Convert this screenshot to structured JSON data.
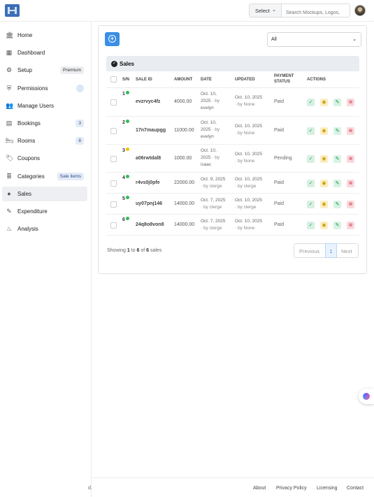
{
  "header": {
    "logo": "logo",
    "select_label": "Select",
    "search_placeholder": "Search Mockups, Logos,"
  },
  "sidebar": {
    "items": [
      {
        "label": "Home",
        "icon": "bank-icon"
      },
      {
        "label": "Dashboard",
        "icon": "grid-icon"
      },
      {
        "label": "Setup",
        "icon": "gear-icon",
        "badge": "Premium"
      },
      {
        "label": "Permissions",
        "icon": "shield-icon"
      },
      {
        "label": "Manage Users",
        "icon": "users-icon"
      },
      {
        "label": "Bookings",
        "icon": "book-icon",
        "badge": "3"
      },
      {
        "label": "Rooms",
        "icon": "bed-icon",
        "badge": "8"
      },
      {
        "label": "Coupons",
        "icon": "coupon-icon"
      },
      {
        "label": "Categories",
        "icon": "layers-icon",
        "badge": "Sale items"
      },
      {
        "label": "Sales",
        "icon": "sales-icon",
        "active": true
      },
      {
        "label": "Expenditure",
        "icon": "edit-icon"
      },
      {
        "label": "Analysis",
        "icon": "analysis-icon"
      }
    ]
  },
  "main": {
    "filter_value": "All",
    "panel_title": "Sales",
    "columns": [
      "S/N",
      "SALE ID",
      "AMOUNT",
      "DATE",
      "UPDATED",
      "PAYMENT",
      "STATUS",
      "ACTIONS"
    ],
    "rows": [
      {
        "sn": "1",
        "status_color": "#2ebd59",
        "sale_id": "evzrvyc4fz",
        "amount": "4000.00",
        "date_l1": "Oct. 10,",
        "date_l2": "2025",
        "date_by": "· by",
        "date_l3": "evelyn",
        "up_l1": "Oct. 10, 2025",
        "up_l2": "· by None",
        "payment": "Paid"
      },
      {
        "sn": "2",
        "status_color": "#2ebd59",
        "sale_id": "17n7maupgg",
        "amount": "11000.00",
        "date_l1": "Oct. 10,",
        "date_l2": "2025",
        "date_by": "· by",
        "date_l3": "evelyn",
        "up_l1": "Oct. 10, 2025",
        "up_l2": "· by None",
        "payment": "Paid"
      },
      {
        "sn": "3",
        "status_color": "#f2c200",
        "sale_id": "a06rwtdal8",
        "amount": "1000.00",
        "date_l1": "Oct. 10,",
        "date_l2": "2025",
        "date_by": "· by",
        "date_l3": "isaac",
        "up_l1": "Oct. 10, 2025",
        "up_l2": "· by None",
        "payment": "Pending"
      },
      {
        "sn": "4",
        "status_color": "#2ebd59",
        "sale_id": "r4vs0j0pfe",
        "amount": "22000.00",
        "date_l1": "Oct. 9, 2025",
        "date_l2": "· by clerge",
        "up_l1": "Oct. 10, 2025",
        "up_l2": "· by clerge",
        "payment": "Paid"
      },
      {
        "sn": "5",
        "status_color": "#2ebd59",
        "sale_id": "uy07pnj146",
        "amount": "14000.00",
        "date_l1": "Oct. 7, 2025",
        "date_l2": "· by clerge",
        "up_l1": "Oct. 10, 2025",
        "up_l2": "· by clerge",
        "payment": "Paid"
      },
      {
        "sn": "6",
        "status_color": "#2ebd59",
        "sale_id": "24q8o8von8",
        "amount": "14000.00",
        "date_l1": "Oct. 7, 2025",
        "date_l2": "· by clerge",
        "up_l1": "Oct. 10, 2025",
        "up_l2": "· by None",
        "payment": "Paid"
      }
    ],
    "showing": {
      "prefix": "Showing",
      "from": "1",
      "to_word": "to",
      "to": "6",
      "of_word": "of",
      "total": "6",
      "suffix": "sales"
    },
    "pager": {
      "prev": "Previous",
      "page": "1",
      "next": "Next"
    }
  },
  "footer": {
    "copyright": "d.",
    "links": [
      "About",
      "Privacy Policy",
      "Licensing",
      "Contact"
    ]
  }
}
